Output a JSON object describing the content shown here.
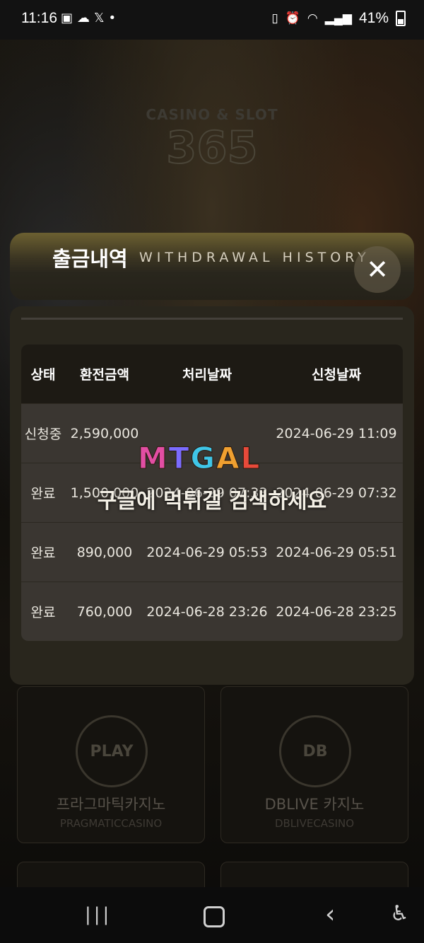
{
  "status_bar": {
    "time": "11:16",
    "left_icons": [
      "gallery-icon",
      "cloud-icon",
      "x-icon",
      "dot-icon"
    ],
    "battery": "41%"
  },
  "background": {
    "logo_top": "CASINO & SLOT",
    "logo_number": "365",
    "cards": [
      {
        "name": "프라그마틱카지노",
        "sub": "PRAGMATICCASINO",
        "badge": "PLAY"
      },
      {
        "name": "DBLIVE 카지노",
        "sub": "DBLIVECASINO",
        "badge": "DB"
      }
    ]
  },
  "modal": {
    "title": "출금내역",
    "subtitle": "WITHDRAWAL HISTORY",
    "close_symbol": "✕",
    "columns": [
      "상태",
      "환전금액",
      "처리날짜",
      "신청날짜"
    ],
    "rows": [
      {
        "status": "신청중",
        "amount": "2,590,000",
        "processed": "",
        "requested": "2024-06-29 11:09"
      },
      {
        "status": "완료",
        "amount": "1,500,000",
        "processed": "2024-06-29 07:33",
        "requested": "2024-06-29 07:32"
      },
      {
        "status": "완료",
        "amount": "890,000",
        "processed": "2024-06-29 05:53",
        "requested": "2024-06-29 05:51"
      },
      {
        "status": "완료",
        "amount": "760,000",
        "processed": "2024-06-28 23:26",
        "requested": "2024-06-28 23:25"
      }
    ]
  },
  "watermark": {
    "logo": "MTGAL",
    "text": "구글에 먹튀갤 검색하세요"
  },
  "colors": {
    "modal_gold": "#6c6031",
    "modal_body": "#29261d",
    "row_bg": "#3a3631"
  }
}
